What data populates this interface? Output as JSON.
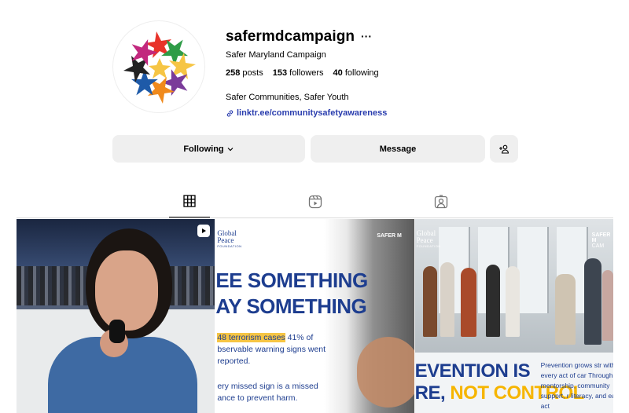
{
  "profile": {
    "username": "safermdcampaign",
    "more_icon": "···",
    "full_name": "Safer Maryland Campaign",
    "stats": {
      "posts_count": "258",
      "posts_label": "posts",
      "followers_count": "153",
      "followers_label": "followers",
      "following_count": "40",
      "following_label": "following"
    },
    "bio": "Safer Communities, Safer Youth",
    "link": "linktr.ee/communitysafetyawareness"
  },
  "actions": {
    "following_label": "Following",
    "message_label": "Message"
  },
  "tabs": [
    {
      "name": "grid-icon",
      "active": true
    },
    {
      "name": "reels-icon",
      "active": false
    },
    {
      "name": "tagged-icon",
      "active": false
    }
  ],
  "posts": {
    "post2": {
      "logo_line1": "Global",
      "logo_line2": "Peace",
      "logo_line3": "FOUNDATION",
      "brand": "SAFER M",
      "headline1": "EE SOMETHING",
      "headline2": "AY SOMETHING",
      "highlight": "48 terrorism cases",
      "text1a": " 41% of",
      "text1b": "bservable warning signs went",
      "text1c": "reported.",
      "text2a": "ery missed sign is a missed",
      "text2b": "ance to prevent harm."
    },
    "post3": {
      "logo_line1": "Global",
      "logo_line2": "Peace",
      "logo_line3": "FOUNDATION",
      "brand": "SAFER M",
      "brand_sub": "CAM",
      "headline1": "EVENTION IS",
      "headline2a": "RE, ",
      "headline2b": "NOT CONTROL",
      "text": "Prevention grows str with every act of car Through mentorship, community support, r literacy, and early act"
    }
  },
  "colors": {
    "accent_blue": "#1d3d8f",
    "link": "#2a3dae",
    "highlight": "#f6c544",
    "button_bg": "#efefef"
  }
}
